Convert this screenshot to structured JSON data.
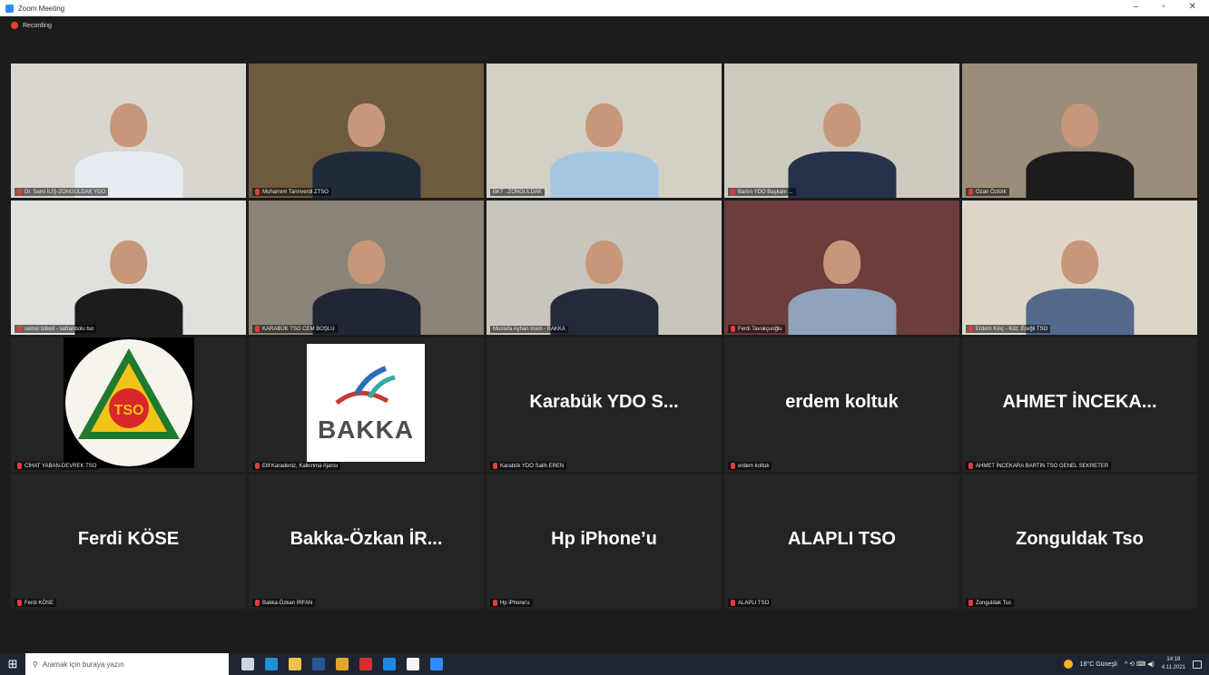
{
  "window": {
    "title": "Zoom Meeting",
    "controls": [
      "–",
      "▫",
      "✕"
    ]
  },
  "recording": {
    "label": "Recording",
    "color": "#e8412c"
  },
  "video_tiles": [
    {
      "name": "Dr. Sami İLİŞ-ZONGULDAK YDO",
      "bg": "#d8d6cf",
      "shirt": "#e7ecf2",
      "active": false
    },
    {
      "name": "Muharrem Tanrıverdi ZTSO",
      "bg": "#6e5a3e",
      "shirt": "#1f2a3a",
      "active": false
    },
    {
      "name": "BKT ..ZONGULDAK",
      "bg": "#d4d0c6",
      "shirt": "#a5c6e0",
      "active": true
    },
    {
      "name": "Bartın YDO Başkanı ...",
      "bg": "#cfcac0",
      "shirt": "#25324a",
      "active": false
    },
    {
      "name": "Ozan Öztürk",
      "bg": "#9a8d79",
      "shirt": "#1c1c1c",
      "active": false
    },
    {
      "name": "cemel tütkeli - safranbolu tso",
      "bg": "#e2e0dc",
      "shirt": "#1c1c1c",
      "active": false
    },
    {
      "name": "KARABÜK TSO CEM BOŞLU",
      "bg": "#8a8377",
      "shirt": "#202634",
      "active": false
    },
    {
      "name": "Mustafa Ayhan İnam - BAKKA",
      "bg": "#c9c5bd",
      "shirt": "#242b38",
      "active": false
    },
    {
      "name": "Ferdi Tavukçuoğlu",
      "bg": "#6b3d3d",
      "shirt": "#8fa3bb",
      "active": false
    },
    {
      "name": "Erdem Kılıç - Kdz. Ereğli TSO",
      "bg": "#ddd6c8",
      "shirt": "#53698a",
      "active": false
    }
  ],
  "logo_tiles": [
    {
      "name": "CİHAT YABAN-DEVREK TSO",
      "logo": "tso-logo",
      "logo_text": "TSO"
    },
    {
      "name": "Elif Karadeniz, Kalkınma Ajansı",
      "logo": "bakka-logo",
      "logo_text": "BAKKA"
    }
  ],
  "text_tiles": [
    {
      "big": "Karabük YDO S...",
      "name": "Karabük YDO Salih EREN"
    },
    {
      "big": "erdem koltuk",
      "name": "erdem koltuk"
    },
    {
      "big": "AHMET İNCEKA...",
      "name": "AHMET İNCEKARA BARTIN TSO GENEL SEKRETER"
    },
    {
      "big": "Ferdi KÖSE",
      "name": "Ferdi KÖSE"
    },
    {
      "big": "Bakka-Özkan İR...",
      "name": "Bakka-Özkan İRFAN"
    },
    {
      "big": "Hp iPhone’u",
      "name": "Hp iPhone'u"
    },
    {
      "big": "ALAPLI TSO",
      "name": "ALAPLI TSO"
    },
    {
      "big": "Zonguldak Tso",
      "name": "Zonguldak Tso"
    }
  ],
  "taskbar": {
    "search_placeholder": "Aramak için buraya yazın",
    "apps": [
      "task-view",
      "edge",
      "file-explorer",
      "word",
      "chrome",
      "acrobat",
      "internet-explorer",
      "store",
      "zoom"
    ],
    "app_colors": [
      "#cfd6e0",
      "#1f8fd6",
      "#f2c14b",
      "#2b5797",
      "#e2a62b",
      "#d32f2f",
      "#1e88e5",
      "#f5f5f5",
      "#2d8cff"
    ],
    "weather": "18°C Güneşli",
    "tray_icons": "^ ⟲ ⌨ ◀)",
    "time": "14:19",
    "date": "4.11.2021"
  }
}
